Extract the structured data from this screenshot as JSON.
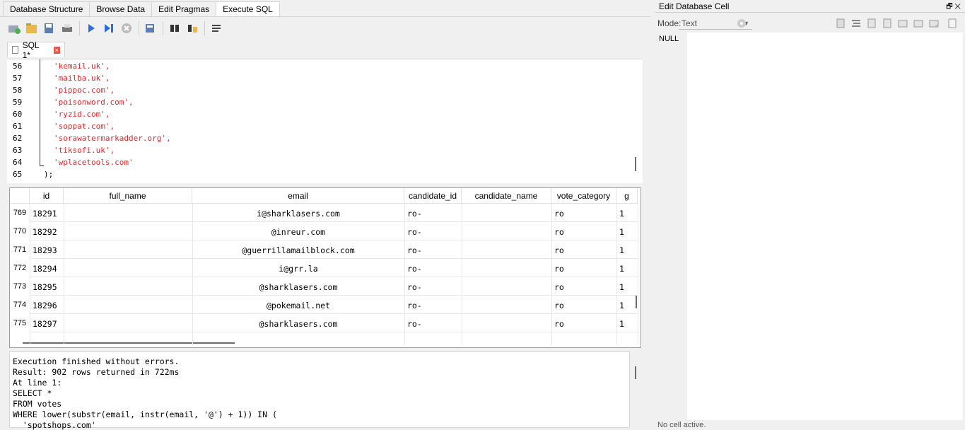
{
  "tabs": [
    "Database Structure",
    "Browse Data",
    "Edit Pragmas",
    "Execute SQL"
  ],
  "active_tab": "Execute SQL",
  "sql_tab": {
    "label": "SQL 1*",
    "close": "×"
  },
  "editor_lines": [
    {
      "num": "56",
      "text": "'kemail.uk',"
    },
    {
      "num": "57",
      "text": "'mailba.uk',"
    },
    {
      "num": "58",
      "text": "'pippoc.com',"
    },
    {
      "num": "59",
      "text": "'poisonword.com',"
    },
    {
      "num": "60",
      "text": "'ryzid.com',"
    },
    {
      "num": "61",
      "text": "'soppat.com',"
    },
    {
      "num": "62",
      "text": "'sorawatermarkadder.org',"
    },
    {
      "num": "63",
      "text": "'tiksofi.uk',"
    },
    {
      "num": "64",
      "text": "'wplacetools.com'"
    },
    {
      "num": "65",
      "text": ");"
    }
  ],
  "grid": {
    "columns": [
      "id",
      "full_name",
      "email",
      "candidate_id",
      "candidate_name",
      "vote_category",
      "g"
    ],
    "rows": [
      {
        "n": "769",
        "id": "18291",
        "email": "i@sharklasers.com",
        "cand": "ro-",
        "cat": "ro",
        "g": "1"
      },
      {
        "n": "770",
        "id": "18292",
        "email": "@inreur.com",
        "cand": "ro-",
        "cat": "ro",
        "g": "1"
      },
      {
        "n": "771",
        "id": "18293",
        "email": "@guerrillamailblock.com",
        "cand": "ro-",
        "cat": "ro",
        "g": "1"
      },
      {
        "n": "772",
        "id": "18294",
        "email": "i@grr.la",
        "cand": "ro-",
        "cat": "ro",
        "g": "1"
      },
      {
        "n": "773",
        "id": "18295",
        "email": "@sharklasers.com",
        "cand": "ro-",
        "cat": "ro",
        "g": "1"
      },
      {
        "n": "774",
        "id": "18296",
        "email": "@pokemail.net",
        "cand": "ro-",
        "cat": "ro",
        "g": "1"
      },
      {
        "n": "775",
        "id": "18297",
        "email": "@sharklasers.com",
        "cand": "ro-",
        "cat": "ro",
        "g": "1"
      }
    ]
  },
  "messages": [
    "Execution finished without errors.",
    "Result: 902 rows returned in 722ms",
    "At line 1:",
    "SELECT *",
    "FROM votes",
    "WHERE lower(substr(email, instr(email, '@') + 1)) IN (",
    "  'spotshops.com'"
  ],
  "right_panel": {
    "title": "Edit Database Cell",
    "title_buttons": "🗗 ✕",
    "mode_label": "Mode:",
    "mode_value": "Text",
    "null_label": "NULL",
    "status": "No cell active."
  }
}
